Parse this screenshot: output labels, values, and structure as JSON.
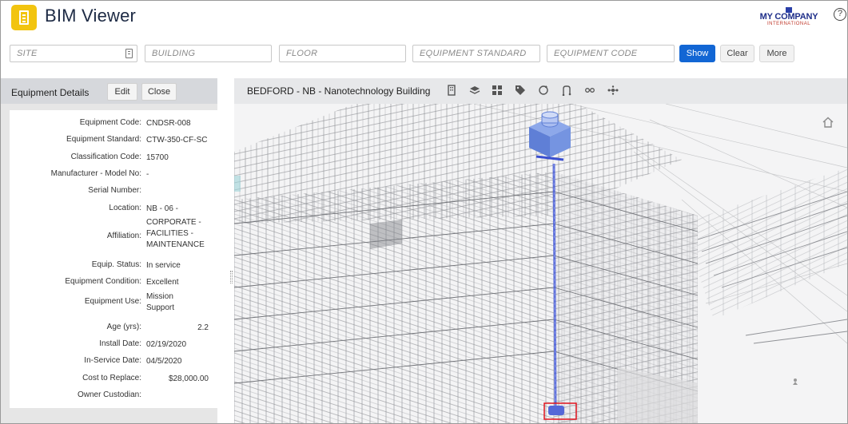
{
  "header": {
    "title": "BIM Viewer",
    "company_name": "MY COMPANY",
    "company_sub": "INTERNATIONAL",
    "help_glyph": "?"
  },
  "filters": {
    "site_placeholder": "SITE",
    "building_placeholder": "BUILDING",
    "floor_placeholder": "FLOOR",
    "standard_placeholder": "EQUIPMENT STANDARD",
    "code_placeholder": "EQUIPMENT CODE",
    "show_label": "Show",
    "clear_label": "Clear",
    "more_label": "More"
  },
  "panel": {
    "title": "Equipment Details",
    "edit_label": "Edit",
    "close_label": "Close",
    "rows": [
      {
        "label": "Equipment Code:",
        "value": "CNDSR-008"
      },
      {
        "label": "Equipment Standard:",
        "value": "CTW-350-CF-SC"
      },
      {
        "label": "Classification Code:",
        "value": "15700"
      },
      {
        "label": "Manufacturer - Model No:",
        "value": "-"
      },
      {
        "label": "Serial Number:",
        "value": ""
      },
      {
        "label": "Location:",
        "value": "NB - 06 -"
      },
      {
        "label": "Affiliation:",
        "value": "CORPORATE -\nFACILITIES -\nMAINTENANCE"
      },
      {
        "label": "Equip. Status:",
        "value": "In service"
      },
      {
        "label": "Equipment Condition:",
        "value": "Excellent"
      },
      {
        "label": "Equipment Use:",
        "value": "Mission\nSupport"
      },
      {
        "label": "Age (yrs):",
        "value": "2.2"
      },
      {
        "label": "Install Date:",
        "value": "02/19/2020"
      },
      {
        "label": "In-Service Date:",
        "value": "04/5/2020"
      },
      {
        "label": "Cost to Replace:",
        "value": "$28,000.00"
      },
      {
        "label": "Owner Custodian:",
        "value": ""
      }
    ]
  },
  "viewer": {
    "title": "BEDFORD - NB - Nanotechnology Building",
    "tools": [
      "building-icon",
      "layers-icon",
      "grid-icon",
      "tag-icon",
      "refresh-icon",
      "route-icon",
      "system-icon",
      "network-icon"
    ]
  },
  "colors": {
    "accent": "#1266d4",
    "logo": "#f2c40f",
    "highlight": "#4a5fd8",
    "selection": "#e0141e"
  }
}
